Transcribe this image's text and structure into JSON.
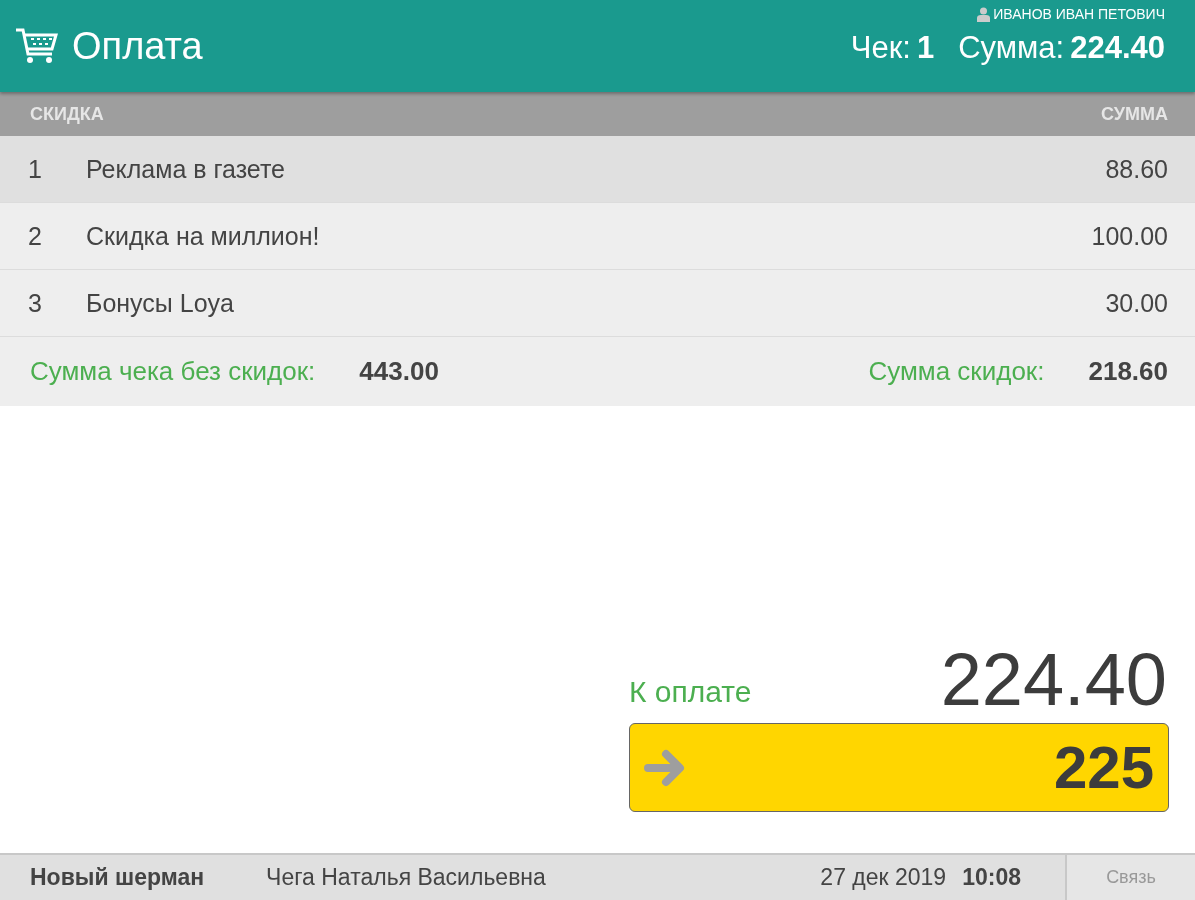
{
  "header": {
    "title": "Оплата",
    "user": "ИВАНОВ ИВАН ПЕТОВИЧ",
    "check_label": "Чек:",
    "check_number": "1",
    "sum_label": "Сумма:",
    "sum_value": "224.40"
  },
  "table": {
    "columns": [
      "СКИДКА",
      "СУММА"
    ],
    "rows": [
      {
        "number": "1",
        "name": "Реклама в газете",
        "amount": "88.60",
        "selected": true
      },
      {
        "number": "2",
        "name": "Скидка на миллион!",
        "amount": "100.00",
        "selected": false
      },
      {
        "number": "3",
        "name": "Бонусы Loya",
        "amount": "30.00",
        "selected": false
      }
    ]
  },
  "totals": {
    "without_discount_label": "Сумма чека без скидок:",
    "without_discount_value": "443.00",
    "discount_label": "Сумма скидок:",
    "discount_value": "218.60"
  },
  "payment": {
    "label": "К оплате",
    "amount": "224.40",
    "input_value": "225"
  },
  "status_bar": {
    "store": "Новый шерман",
    "cashier": "Чега Наталья Васильевна",
    "date": "27 дек 2019",
    "time": "10:08",
    "link_button": "Связь"
  }
}
